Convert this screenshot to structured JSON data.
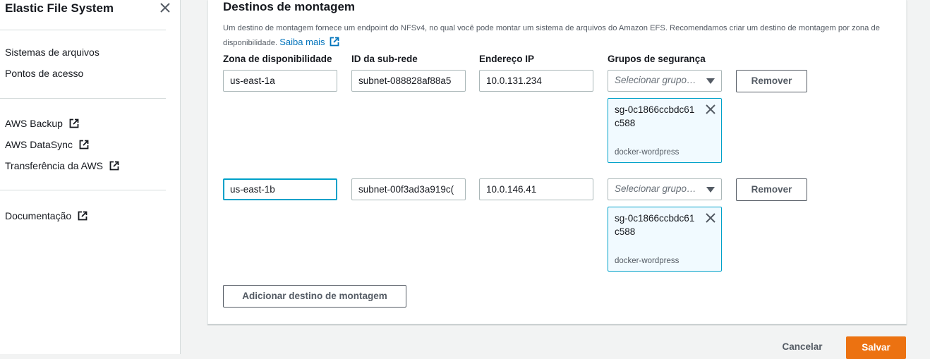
{
  "sidebar": {
    "title": "Elastic File System",
    "close_icon": "close-icon",
    "nav": [
      {
        "label": "Sistemas de arquivos"
      },
      {
        "label": "Pontos de acesso"
      }
    ],
    "services": [
      {
        "label": "AWS Backup",
        "icon": "external-link-icon"
      },
      {
        "label": "AWS DataSync",
        "icon": "external-link-icon"
      },
      {
        "label": "Transferência da AWS",
        "icon": "external-link-icon"
      }
    ],
    "docs": {
      "label": "Documentação",
      "icon": "external-link-icon"
    }
  },
  "mount_targets": {
    "title": "Destinos de montagem",
    "description": "Um destino de montagem fornece um endpoint do NFSv4, no qual você pode montar um sistema de arquivos do Amazon EFS. Recomendamos criar um destino de montagem por zona de disponibilidade.",
    "learn_more": "Saiba mais",
    "columns": {
      "zone": "Zona de disponibilidade",
      "subnet": "ID da sub-rede",
      "ip": "Endereço IP",
      "groups": "Grupos de segurança"
    },
    "rows": [
      {
        "zone": "us-east-1a",
        "subnet": "subnet-088828af88a5",
        "ip": "10.0.131.234",
        "groups_placeholder": "Selecionar grupo…",
        "remove_label": "Remover",
        "token": {
          "id": "sg-0c1866ccbdc61c588",
          "name": "docker-wordpress"
        }
      },
      {
        "zone": "us-east-1b",
        "subnet": "subnet-00f3ad3a919c(",
        "ip": "10.0.146.41",
        "groups_placeholder": "Selecionar grupo…",
        "remove_label": "Remover",
        "token": {
          "id": "sg-0c1866ccbdc61c588",
          "name": "docker-wordpress"
        }
      }
    ],
    "add_label": "Adicionar destino de montagem"
  },
  "footer": {
    "cancel_label": "Cancelar",
    "save_label": "Salvar"
  },
  "colors": {
    "accent_link": "#0073bb",
    "primary_button": "#ec7211",
    "focus_border": "#00a1c9",
    "token_background": "#f1faff"
  }
}
